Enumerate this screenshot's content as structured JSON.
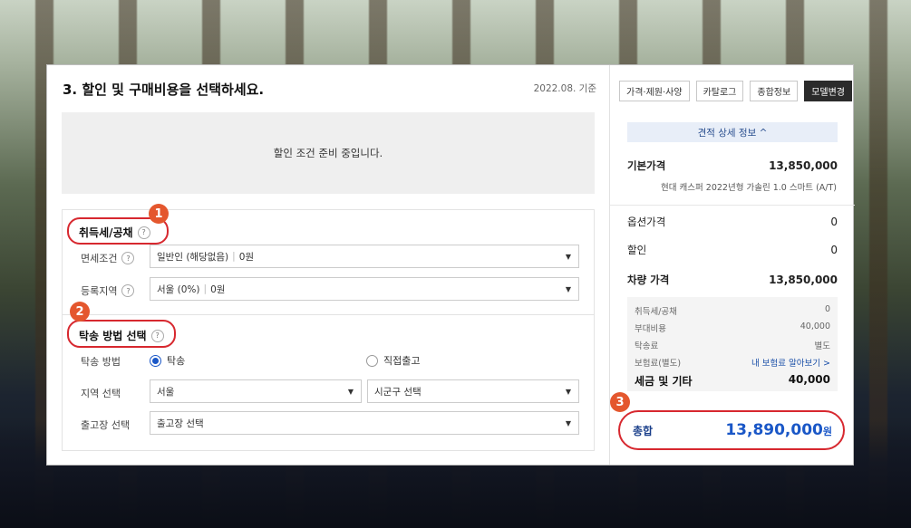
{
  "page": {
    "title": "3. 할인 및 구매비용을 선택하세요.",
    "basis": "2022.08. 기준",
    "discount_notice": "할인 조건 준비 중입니다."
  },
  "badges": [
    "1",
    "2",
    "3"
  ],
  "tax_section": {
    "title": "취득세/공채",
    "help": "?",
    "exemption": {
      "label": "면세조건",
      "help": "?",
      "value": "일반인 (해당없음)",
      "amount": "0원"
    },
    "region": {
      "label": "등록지역",
      "help": "?",
      "value": "서울 (0%)",
      "amount": "0원"
    }
  },
  "delivery_section": {
    "title": "탁송 방법 선택",
    "help": "?",
    "method": {
      "label": "탁송 방법",
      "options": [
        "탁송",
        "직접출고"
      ],
      "selected": "탁송"
    },
    "area": {
      "label": "지역 선택",
      "city": "서울",
      "district": "시군구 선택"
    },
    "depot": {
      "label": "출고장 선택",
      "value": "출고장 선택"
    }
  },
  "tabs": [
    "가격·제원·사양",
    "카탈로그",
    "종합정보",
    "모델변경"
  ],
  "estimate": {
    "toggle_label": "견적 상세 정보 ^",
    "base_price": {
      "label": "기본가격",
      "value": "13,850,000"
    },
    "model": "현대 캐스퍼 2022년형 가솔린 1.0 스마트 (A/T)",
    "option_price": {
      "label": "옵션가격",
      "value": "0"
    },
    "discount": {
      "label": "할인",
      "value": "0"
    },
    "vehicle_price": {
      "label": "차량 가격",
      "value": "13,850,000"
    },
    "tax_items": [
      {
        "label": "취득세/공채",
        "value": "0"
      },
      {
        "label": "부대비용",
        "value": "40,000"
      },
      {
        "label": "탁송료",
        "value": "별도"
      },
      {
        "label": "보험료(별도)",
        "value": "내 보험료 알아보기 >"
      }
    ],
    "tax_total": {
      "label": "세금 및 기타",
      "value": "40,000"
    },
    "total": {
      "label": "총합",
      "value": "13,890,000",
      "unit": "원"
    }
  },
  "colors": {
    "accent": "#1a57c7",
    "highlight": "#d7282f",
    "badge": "#e4572e"
  }
}
